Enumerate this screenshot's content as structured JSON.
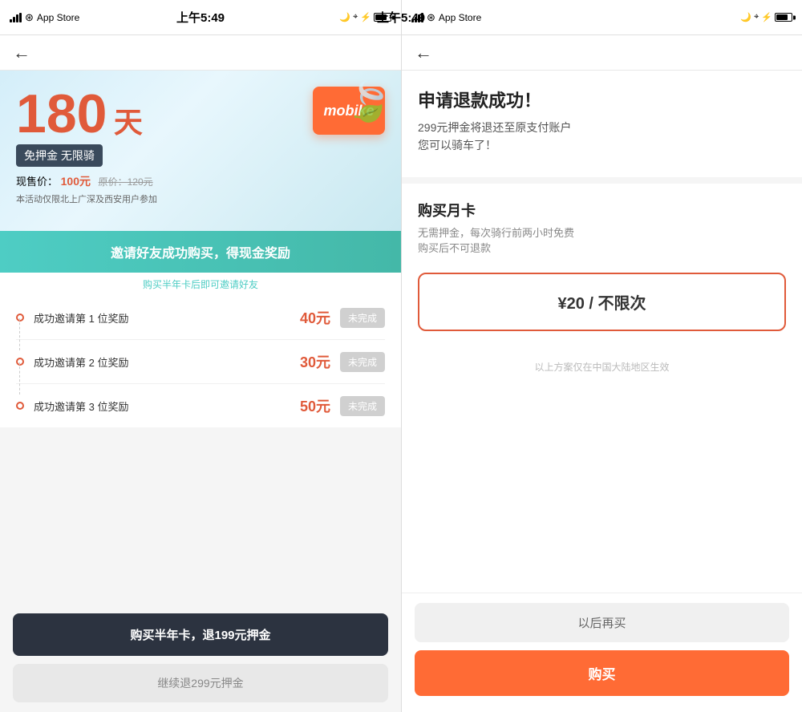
{
  "left_screen": {
    "status_bar": {
      "app_name": "App Store",
      "time": "上午5:49"
    },
    "hero": {
      "days": "180",
      "days_unit": "天",
      "badge": "免押金 无限骑",
      "current_price_label": "现售价：",
      "current_price": "100元",
      "original_price": "原价：120元",
      "note": "本活动仅限北上广深及西安用户参加",
      "mobike_label": "mobike"
    },
    "invite_banner": {
      "title": "邀请好友成功购买，得现金奖励",
      "sub": "购买半年卡后即可邀请好友"
    },
    "rewards": [
      {
        "label": "成功邀请第 1 位奖励",
        "amount": "40元",
        "btn": "未完成"
      },
      {
        "label": "成功邀请第 2 位奖励",
        "amount": "30元",
        "btn": "未完成"
      },
      {
        "label": "成功邀请第 3 位奖励",
        "amount": "50元",
        "btn": "未完成"
      }
    ],
    "buttons": {
      "primary": "购买半年卡，退199元押金",
      "secondary": "继续退299元押金"
    }
  },
  "right_screen": {
    "status_bar": {
      "app_name": "App Store",
      "time": "上午5:49"
    },
    "success_title": "申请退款成功！",
    "success_desc": "299元押金将退还至原支付账户\n您可以骑车了！",
    "purchase_section": {
      "title": "购买月卡",
      "desc": "无需押金，每次骑行前两小时免费\n购买后不可退款",
      "price": "¥20 / 不限次",
      "region_note": "以上方案仅在中国大陆地区生效"
    },
    "buttons": {
      "later": "以后再买",
      "buy": "购买"
    }
  }
}
